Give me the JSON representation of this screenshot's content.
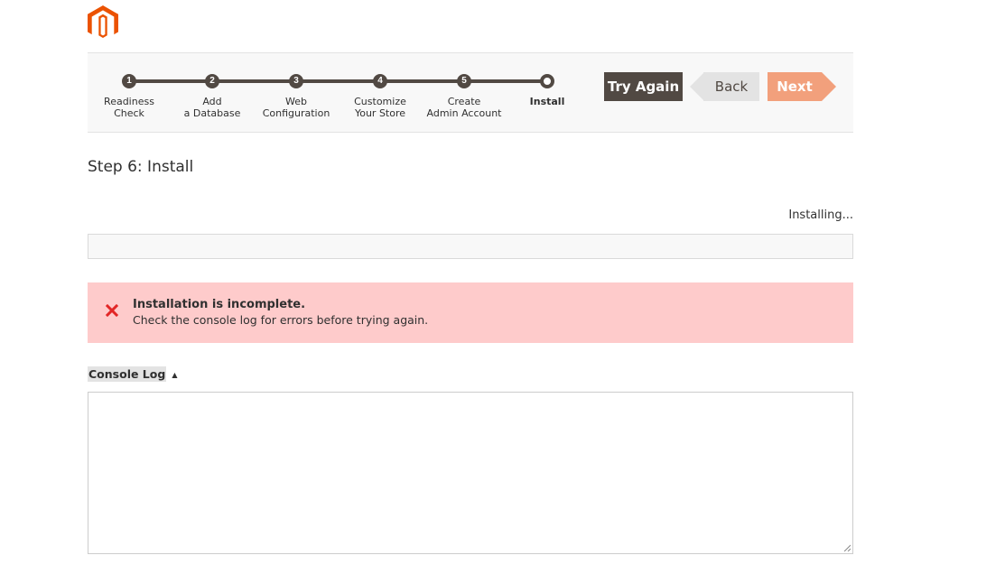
{
  "brand": {
    "logo_icon": "magento-logo-icon",
    "accent": "#eb5202"
  },
  "steps": [
    {
      "number": "1",
      "label_line1": "Readiness",
      "label_line2": "Check"
    },
    {
      "number": "2",
      "label_line1": "Add",
      "label_line2": "a Database"
    },
    {
      "number": "3",
      "label_line1": "Web",
      "label_line2": "Configuration"
    },
    {
      "number": "4",
      "label_line1": "Customize",
      "label_line2": "Your Store"
    },
    {
      "number": "5",
      "label_line1": "Create",
      "label_line2": "Admin Account"
    },
    {
      "number": "",
      "label_line1": "Install",
      "label_line2": ""
    }
  ],
  "buttons": {
    "try_again": "Try Again",
    "back": "Back",
    "next": "Next"
  },
  "page_title": "Step 6: Install",
  "progress": {
    "status": "Installing...",
    "percent": 0
  },
  "alert": {
    "title": "Installation is incomplete.",
    "text": "Check the console log for errors before trying again.",
    "icon": "error-x-icon",
    "color": "#e22626"
  },
  "console": {
    "label": "Console Log",
    "caret": "▲",
    "content": ""
  }
}
